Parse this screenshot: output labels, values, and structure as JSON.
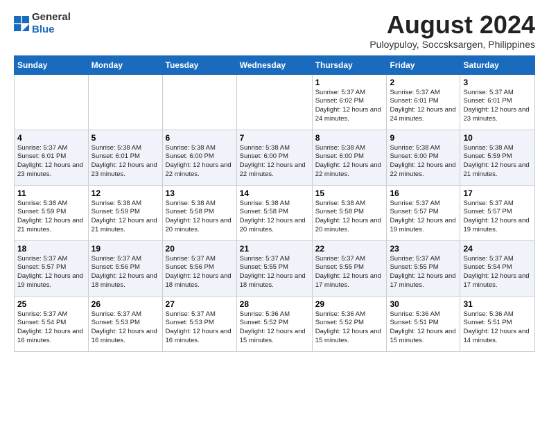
{
  "logo": {
    "general": "General",
    "blue": "Blue"
  },
  "title": "August 2024",
  "subtitle": "Puloypuloy, Soccsksargen, Philippines",
  "days_of_week": [
    "Sunday",
    "Monday",
    "Tuesday",
    "Wednesday",
    "Thursday",
    "Friday",
    "Saturday"
  ],
  "weeks": [
    [
      {
        "day": "",
        "info": ""
      },
      {
        "day": "",
        "info": ""
      },
      {
        "day": "",
        "info": ""
      },
      {
        "day": "",
        "info": ""
      },
      {
        "day": "1",
        "info": "Sunrise: 5:37 AM\nSunset: 6:02 PM\nDaylight: 12 hours\nand 24 minutes."
      },
      {
        "day": "2",
        "info": "Sunrise: 5:37 AM\nSunset: 6:01 PM\nDaylight: 12 hours\nand 24 minutes."
      },
      {
        "day": "3",
        "info": "Sunrise: 5:37 AM\nSunset: 6:01 PM\nDaylight: 12 hours\nand 23 minutes."
      }
    ],
    [
      {
        "day": "4",
        "info": "Sunrise: 5:37 AM\nSunset: 6:01 PM\nDaylight: 12 hours\nand 23 minutes."
      },
      {
        "day": "5",
        "info": "Sunrise: 5:38 AM\nSunset: 6:01 PM\nDaylight: 12 hours\nand 23 minutes."
      },
      {
        "day": "6",
        "info": "Sunrise: 5:38 AM\nSunset: 6:00 PM\nDaylight: 12 hours\nand 22 minutes."
      },
      {
        "day": "7",
        "info": "Sunrise: 5:38 AM\nSunset: 6:00 PM\nDaylight: 12 hours\nand 22 minutes."
      },
      {
        "day": "8",
        "info": "Sunrise: 5:38 AM\nSunset: 6:00 PM\nDaylight: 12 hours\nand 22 minutes."
      },
      {
        "day": "9",
        "info": "Sunrise: 5:38 AM\nSunset: 6:00 PM\nDaylight: 12 hours\nand 22 minutes."
      },
      {
        "day": "10",
        "info": "Sunrise: 5:38 AM\nSunset: 5:59 PM\nDaylight: 12 hours\nand 21 minutes."
      }
    ],
    [
      {
        "day": "11",
        "info": "Sunrise: 5:38 AM\nSunset: 5:59 PM\nDaylight: 12 hours\nand 21 minutes."
      },
      {
        "day": "12",
        "info": "Sunrise: 5:38 AM\nSunset: 5:59 PM\nDaylight: 12 hours\nand 21 minutes."
      },
      {
        "day": "13",
        "info": "Sunrise: 5:38 AM\nSunset: 5:58 PM\nDaylight: 12 hours\nand 20 minutes."
      },
      {
        "day": "14",
        "info": "Sunrise: 5:38 AM\nSunset: 5:58 PM\nDaylight: 12 hours\nand 20 minutes."
      },
      {
        "day": "15",
        "info": "Sunrise: 5:38 AM\nSunset: 5:58 PM\nDaylight: 12 hours\nand 20 minutes."
      },
      {
        "day": "16",
        "info": "Sunrise: 5:37 AM\nSunset: 5:57 PM\nDaylight: 12 hours\nand 19 minutes."
      },
      {
        "day": "17",
        "info": "Sunrise: 5:37 AM\nSunset: 5:57 PM\nDaylight: 12 hours\nand 19 minutes."
      }
    ],
    [
      {
        "day": "18",
        "info": "Sunrise: 5:37 AM\nSunset: 5:57 PM\nDaylight: 12 hours\nand 19 minutes."
      },
      {
        "day": "19",
        "info": "Sunrise: 5:37 AM\nSunset: 5:56 PM\nDaylight: 12 hours\nand 18 minutes."
      },
      {
        "day": "20",
        "info": "Sunrise: 5:37 AM\nSunset: 5:56 PM\nDaylight: 12 hours\nand 18 minutes."
      },
      {
        "day": "21",
        "info": "Sunrise: 5:37 AM\nSunset: 5:55 PM\nDaylight: 12 hours\nand 18 minutes."
      },
      {
        "day": "22",
        "info": "Sunrise: 5:37 AM\nSunset: 5:55 PM\nDaylight: 12 hours\nand 17 minutes."
      },
      {
        "day": "23",
        "info": "Sunrise: 5:37 AM\nSunset: 5:55 PM\nDaylight: 12 hours\nand 17 minutes."
      },
      {
        "day": "24",
        "info": "Sunrise: 5:37 AM\nSunset: 5:54 PM\nDaylight: 12 hours\nand 17 minutes."
      }
    ],
    [
      {
        "day": "25",
        "info": "Sunrise: 5:37 AM\nSunset: 5:54 PM\nDaylight: 12 hours\nand 16 minutes."
      },
      {
        "day": "26",
        "info": "Sunrise: 5:37 AM\nSunset: 5:53 PM\nDaylight: 12 hours\nand 16 minutes."
      },
      {
        "day": "27",
        "info": "Sunrise: 5:37 AM\nSunset: 5:53 PM\nDaylight: 12 hours\nand 16 minutes."
      },
      {
        "day": "28",
        "info": "Sunrise: 5:36 AM\nSunset: 5:52 PM\nDaylight: 12 hours\nand 15 minutes."
      },
      {
        "day": "29",
        "info": "Sunrise: 5:36 AM\nSunset: 5:52 PM\nDaylight: 12 hours\nand 15 minutes."
      },
      {
        "day": "30",
        "info": "Sunrise: 5:36 AM\nSunset: 5:51 PM\nDaylight: 12 hours\nand 15 minutes."
      },
      {
        "day": "31",
        "info": "Sunrise: 5:36 AM\nSunset: 5:51 PM\nDaylight: 12 hours\nand 14 minutes."
      }
    ]
  ]
}
